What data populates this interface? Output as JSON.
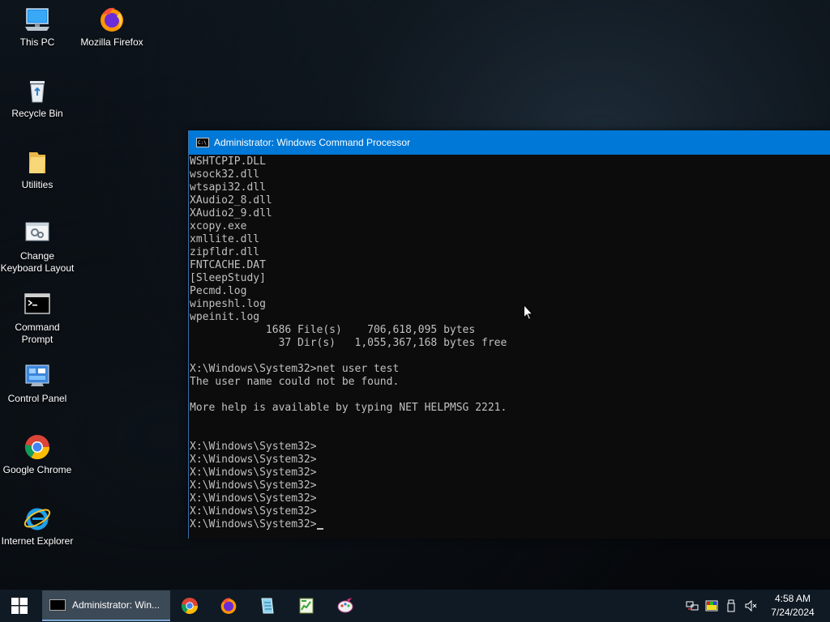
{
  "desktop": {
    "icons": [
      {
        "label": "This PC"
      },
      {
        "label": "Mozilla Firefox"
      },
      {
        "label": "Recycle Bin"
      },
      {
        "label": "Utilities"
      },
      {
        "label": "Change\nKeyboard Layout"
      },
      {
        "label": "Command\nPrompt"
      },
      {
        "label": "Control Panel"
      },
      {
        "label": "Google Chrome"
      },
      {
        "label": "Internet Explorer"
      }
    ]
  },
  "cmd_window": {
    "title": "Administrator: Windows Command Processor",
    "icon_text": "C:\\",
    "lines": [
      "WSHTCPIP.DLL",
      "wsock32.dll",
      "wtsapi32.dll",
      "XAudio2_8.dll",
      "XAudio2_9.dll",
      "xcopy.exe",
      "xmllite.dll",
      "zipfldr.dll",
      "FNTCACHE.DAT",
      "[SleepStudy]",
      "Pecmd.log",
      "winpeshl.log",
      "wpeinit.log",
      "            1686 File(s)    706,618,095 bytes",
      "              37 Dir(s)   1,055,367,168 bytes free",
      "",
      "X:\\Windows\\System32>net user test",
      "The user name could not be found.",
      "",
      "More help is available by typing NET HELPMSG 2221.",
      "",
      "",
      "X:\\Windows\\System32>",
      "X:\\Windows\\System32>",
      "X:\\Windows\\System32>",
      "X:\\Windows\\System32>",
      "X:\\Windows\\System32>",
      "X:\\Windows\\System32>",
      "X:\\Windows\\System32>"
    ]
  },
  "taskbar": {
    "active_task_label": "Administrator: Win...",
    "pinned": [
      "chrome-icon",
      "firefox-icon",
      "notepad-icon",
      "spreadsheet-icon",
      "paint-icon"
    ],
    "tray": [
      "network-icon",
      "color-icon",
      "usb-icon",
      "volume-muted-icon"
    ],
    "clock": {
      "time": "4:58 AM",
      "date": "7/24/2024"
    }
  }
}
